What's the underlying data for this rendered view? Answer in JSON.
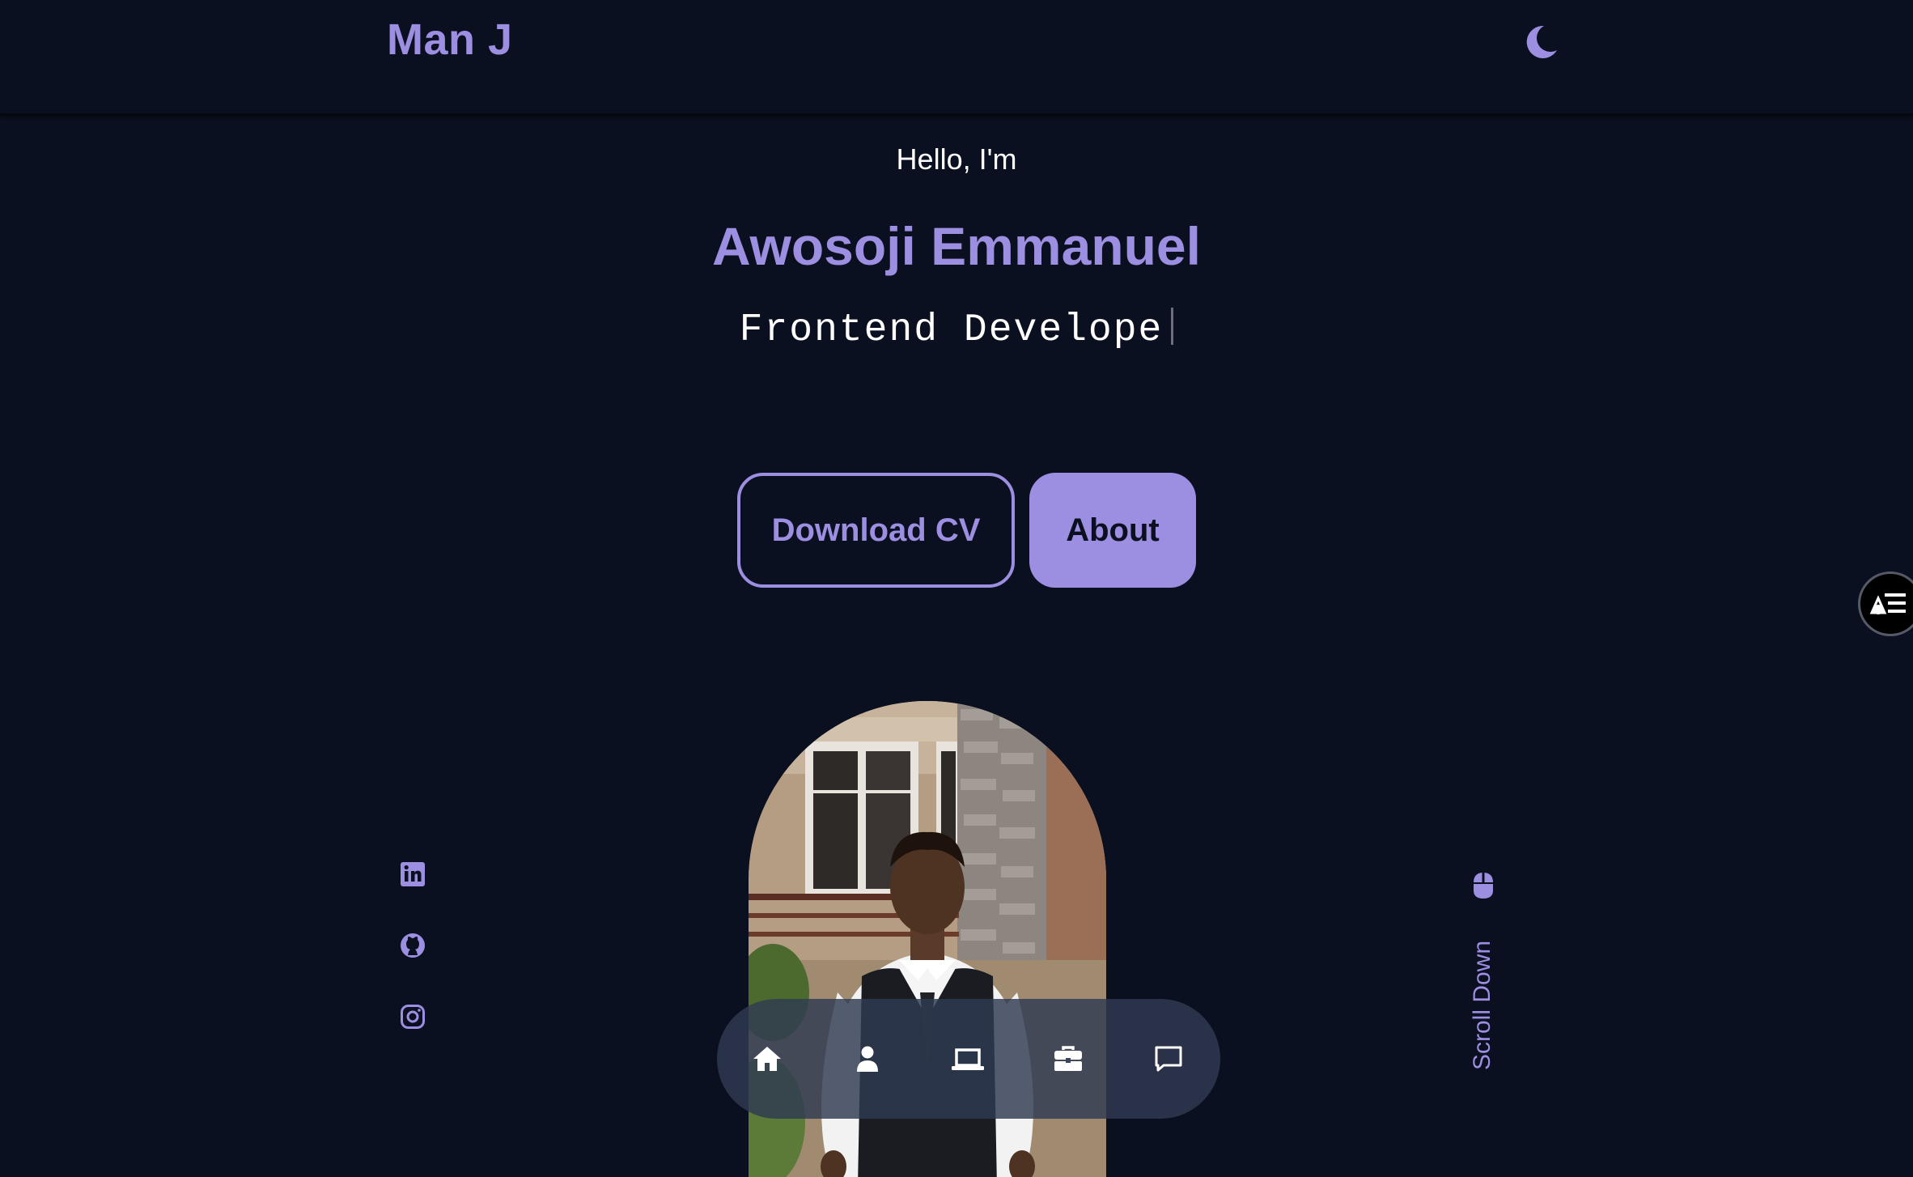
{
  "header": {
    "logo": "Man J",
    "theme_icon": "moon-icon"
  },
  "hero": {
    "greeting": "Hello, I'm",
    "name": "Awosoji Emmanuel",
    "role": "Frontend Develope"
  },
  "buttons": {
    "download_cv": "Download CV",
    "about": "About"
  },
  "social": [
    {
      "icon": "linkedin-icon"
    },
    {
      "icon": "github-icon"
    },
    {
      "icon": "instagram-icon"
    }
  ],
  "scroll": {
    "label": "Scroll Down",
    "icon": "mouse-icon"
  },
  "bottom_nav": [
    {
      "icon": "home-icon"
    },
    {
      "icon": "user-icon"
    },
    {
      "icon": "laptop-icon"
    },
    {
      "icon": "briefcase-icon"
    },
    {
      "icon": "message-icon"
    }
  ],
  "colors": {
    "background": "#0b1020",
    "accent": "#9c8ee0",
    "text": "#ffffff"
  }
}
